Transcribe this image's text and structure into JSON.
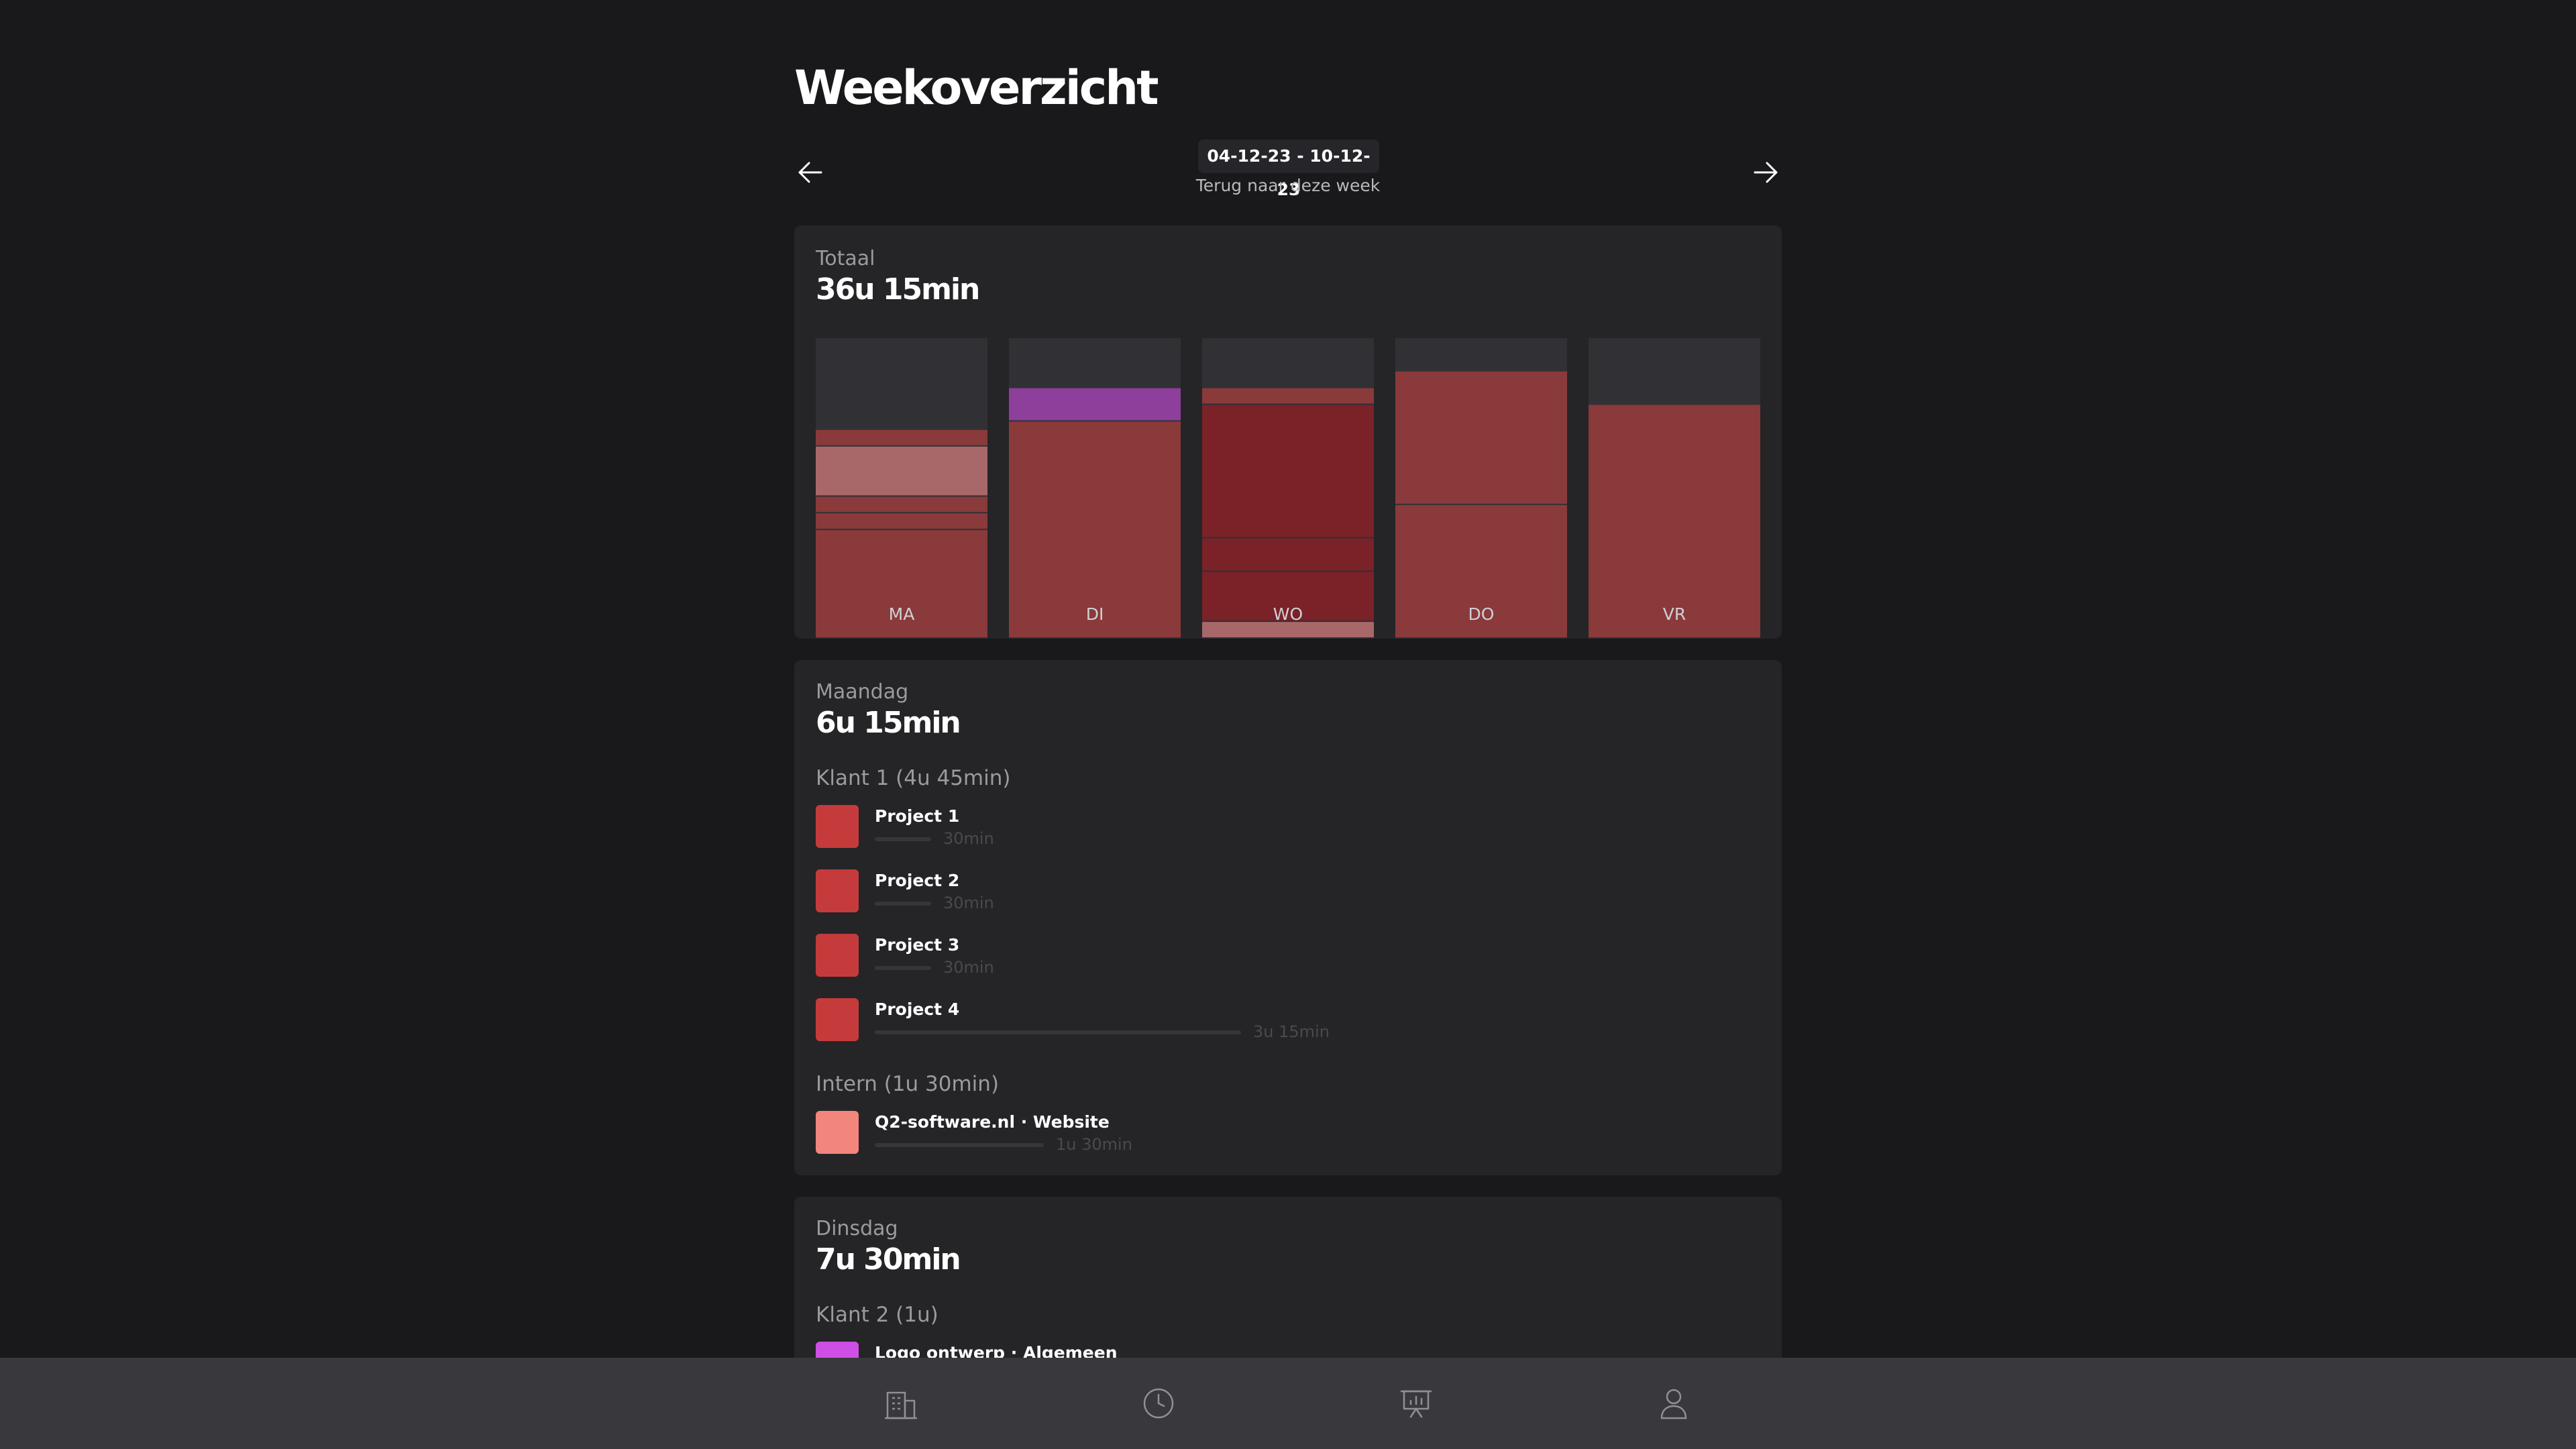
{
  "page": {
    "title": "Weekoverzicht",
    "week_range": "04-12-23 - 10-12-23",
    "back_link": "Terug naar deze week"
  },
  "icons": {
    "prev": "arrow-left-icon",
    "next": "arrow-right-icon"
  },
  "total": {
    "label": "Totaal",
    "value": "36u 15min"
  },
  "chart_data": {
    "type": "bar",
    "stacked": true,
    "categories": [
      "MA",
      "DI",
      "WO",
      "DO",
      "VR"
    ],
    "capacity_hours": 9,
    "grid": false,
    "bars": [
      {
        "day": "MA",
        "segments": [
          {
            "hours": 3.25,
            "color": "#8a3a3b"
          },
          {
            "hours": 0.5,
            "color": "#8a3a3b"
          },
          {
            "hours": 0.5,
            "color": "#8a3a3b"
          },
          {
            "hours": 1.5,
            "color": "#a8686a"
          },
          {
            "hours": 0.5,
            "color": "#8a3a3b"
          }
        ]
      },
      {
        "day": "DI",
        "segments": [
          {
            "hours": 6.5,
            "color": "#8a3a3b"
          },
          {
            "hours": 1.0,
            "color": "#8e3f9c"
          }
        ]
      },
      {
        "day": "WO",
        "segments": [
          {
            "hours": 0.5,
            "color": "#a8686a"
          },
          {
            "hours": 1.5,
            "color": "#7a2228"
          },
          {
            "hours": 1.0,
            "color": "#7a2228"
          },
          {
            "hours": 4.0,
            "color": "#7a2228"
          },
          {
            "hours": 0.5,
            "color": "#8a3a3b"
          }
        ]
      },
      {
        "day": "DO",
        "segments": [
          {
            "hours": 4.0,
            "color": "#8a3a3b"
          },
          {
            "hours": 4.0,
            "color": "#8a3a3b"
          }
        ]
      },
      {
        "day": "VR",
        "segments": [
          {
            "hours": 7.0,
            "color": "#8a3a3b"
          }
        ]
      }
    ],
    "colors": {
      "track": "#313135",
      "label": "#d0d0d4"
    }
  },
  "maandag": {
    "label": "Maandag",
    "value": "6u 15min",
    "groups": [
      {
        "label": "Klant 1 (4u 45min)",
        "items": [
          {
            "name": "Project 1",
            "duration": "30min",
            "hours": 0.5,
            "color": "#c53b3b"
          },
          {
            "name": "Project 2",
            "duration": "30min",
            "hours": 0.5,
            "color": "#c53b3b"
          },
          {
            "name": "Project 3",
            "duration": "30min",
            "hours": 0.5,
            "color": "#c53b3b"
          },
          {
            "name": "Project 4",
            "duration": "3u 15min",
            "hours": 3.25,
            "color": "#c53b3b"
          }
        ]
      },
      {
        "label": "Intern (1u 30min)",
        "items": [
          {
            "name": "Q2-software.nl · Website",
            "duration": "1u 30min",
            "hours": 1.5,
            "color": "#f2867d"
          }
        ]
      }
    ]
  },
  "dinsdag": {
    "label": "Dinsdag",
    "value": "7u 30min",
    "groups": [
      {
        "label": "Klant 2 (1u)",
        "items": [
          {
            "name": "Logo ontwerp · Algemeen",
            "color": "#cf4fe6"
          }
        ]
      }
    ]
  },
  "bottom_nav": [
    {
      "name": "clients",
      "icon": "building-icon",
      "active": false
    },
    {
      "name": "time",
      "icon": "clock-icon",
      "active": false
    },
    {
      "name": "reports",
      "icon": "presentation-chart-icon",
      "active": true
    },
    {
      "name": "profile",
      "icon": "user-icon",
      "active": false
    }
  ]
}
